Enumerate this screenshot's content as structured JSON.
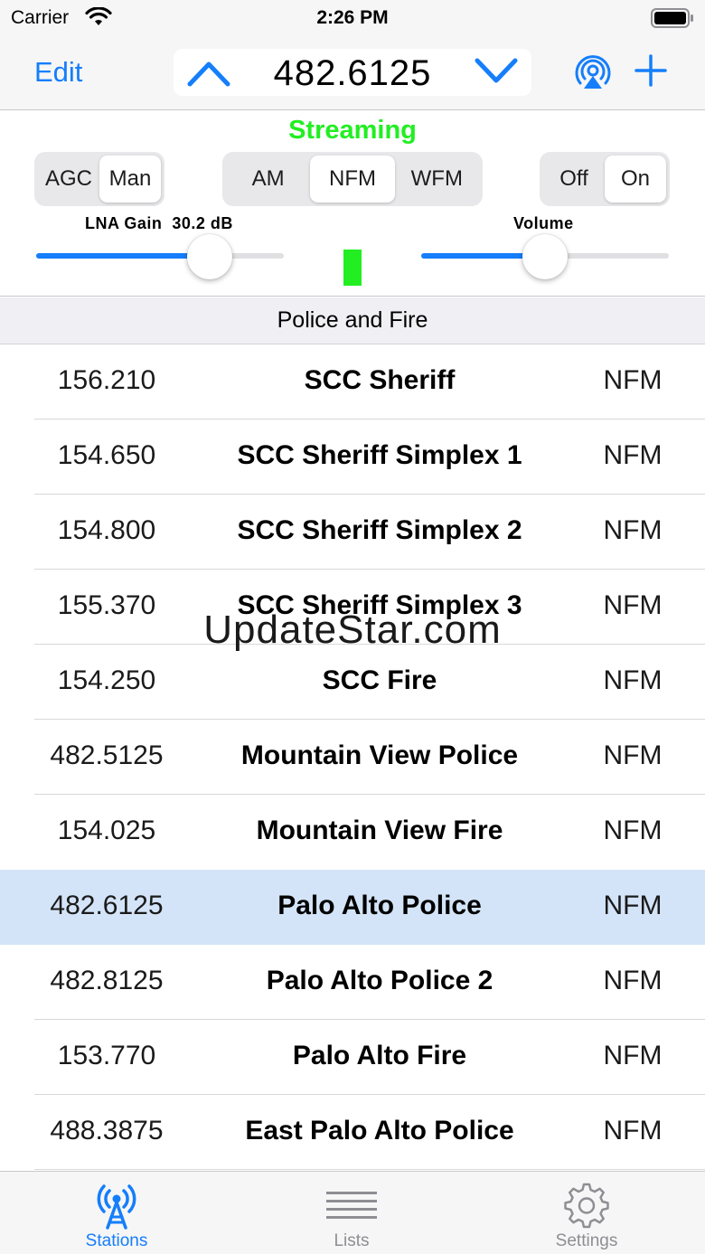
{
  "status_bar": {
    "carrier": "Carrier",
    "time": "2:26 PM"
  },
  "nav": {
    "edit_label": "Edit",
    "frequency": "482.6125"
  },
  "controls": {
    "status": "Streaming",
    "status_color": "#22ee22",
    "agc_segments": [
      "AGC",
      "Man"
    ],
    "agc_selected": "Man",
    "mode_segments": [
      "AM",
      "NFM",
      "WFM"
    ],
    "mode_selected": "NFM",
    "power_segments": [
      "Off",
      "On"
    ],
    "power_selected": "On",
    "gain_label": "LNA Gain",
    "gain_value": "30.2 dB",
    "gain_level": 0.7,
    "volume_label": "Volume",
    "volume_level": 0.5
  },
  "section": {
    "title": "Police and Fire"
  },
  "stations": [
    {
      "frequency": "156.210",
      "name": "SCC Sheriff",
      "mode": "NFM"
    },
    {
      "frequency": "154.650",
      "name": "SCC Sheriff Simplex 1",
      "mode": "NFM"
    },
    {
      "frequency": "154.800",
      "name": "SCC Sheriff Simplex 2",
      "mode": "NFM"
    },
    {
      "frequency": "155.370",
      "name": "SCC Sheriff Simplex 3",
      "mode": "NFM"
    },
    {
      "frequency": "154.250",
      "name": "SCC Fire",
      "mode": "NFM"
    },
    {
      "frequency": "482.5125",
      "name": "Mountain View Police",
      "mode": "NFM"
    },
    {
      "frequency": "154.025",
      "name": "Mountain View Fire",
      "mode": "NFM"
    },
    {
      "frequency": "482.6125",
      "name": "Palo Alto Police",
      "mode": "NFM",
      "selected": true
    },
    {
      "frequency": "482.8125",
      "name": "Palo Alto Police 2",
      "mode": "NFM"
    },
    {
      "frequency": "153.770",
      "name": "Palo Alto Fire",
      "mode": "NFM"
    },
    {
      "frequency": "488.3875",
      "name": "East Palo Alto Police",
      "mode": "NFM"
    }
  ],
  "watermark": "UpdateStar.com",
  "tabs": [
    {
      "label": "Stations",
      "icon": "radio-tower-icon",
      "active": true
    },
    {
      "label": "Lists",
      "icon": "list-icon",
      "active": false
    },
    {
      "label": "Settings",
      "icon": "gear-icon",
      "active": false
    }
  ],
  "colors": {
    "accent": "#157efb",
    "selected_row": "#d4e4f8",
    "inactive_tab": "#8e8e93"
  }
}
